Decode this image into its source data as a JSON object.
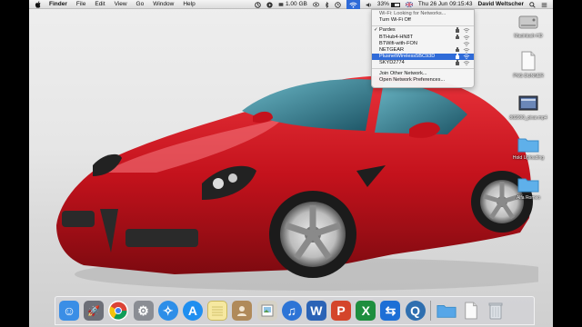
{
  "menubar": {
    "items": [
      "Finder",
      "File",
      "Edit",
      "View",
      "Go",
      "Window",
      "Help"
    ],
    "battery": "33%",
    "storage": "1.00 GB",
    "clock": "Thu 26 Jun  09:15:43",
    "user": "David Weltscher"
  },
  "wifi_menu": {
    "status": "Wi-Fi: Looking for Networks...",
    "toggle": "Turn Wi-Fi Off",
    "networks": [
      {
        "name": "Pardes",
        "checked": true,
        "locked": true
      },
      {
        "name": "BTHub4-HN8T",
        "checked": false,
        "locked": true
      },
      {
        "name": "BTWifi-with-FON",
        "checked": false,
        "locked": false
      },
      {
        "name": "NETGEAR",
        "checked": false,
        "locked": true
      },
      {
        "name": "PlusnetWireless5BC93D",
        "checked": false,
        "locked": true,
        "selected": true
      },
      {
        "name": "SKYD2774",
        "checked": false,
        "locked": true
      }
    ],
    "join_other": "Join Other Network...",
    "preferences": "Open Network Preferences...",
    "checkmark": "✓"
  },
  "desktop_icons": [
    {
      "label": "Macintosh HD",
      "icon": "hard-drive-icon"
    },
    {
      "label": "PNG DUNNER",
      "icon": "document-icon"
    },
    {
      "label": "802900_pixar.mp4",
      "icon": "video-file-icon"
    },
    {
      "label": "Hold Uploading",
      "icon": "folder-icon"
    },
    {
      "label": "Alfa Romeo",
      "icon": "folder-icon"
    }
  ],
  "dock_apps": [
    {
      "name": "finder",
      "glyph": "☺",
      "color": "#3a8ee6"
    },
    {
      "name": "launchpad",
      "glyph": "🚀",
      "color": "#6d6f78"
    },
    {
      "name": "chrome",
      "glyph": "",
      "color": "#ffffff"
    },
    {
      "name": "system-preferences",
      "glyph": "⚙",
      "color": "#8a8d94"
    },
    {
      "name": "safari",
      "glyph": "✧",
      "color": "#2d8ee8"
    },
    {
      "name": "app-store",
      "glyph": "A",
      "color": "#1f8ff0"
    },
    {
      "name": "notes",
      "glyph": "",
      "color": "#f6e8a0"
    },
    {
      "name": "contacts",
      "glyph": "",
      "color": "#b08a5a"
    },
    {
      "name": "preview",
      "glyph": "",
      "color": "#d6d2c6"
    },
    {
      "name": "itunes",
      "glyph": "♫",
      "color": "#2d74d6"
    },
    {
      "name": "word",
      "glyph": "W",
      "color": "#2b63b6"
    },
    {
      "name": "powerpoint",
      "glyph": "P",
      "color": "#d4452b"
    },
    {
      "name": "excel",
      "glyph": "X",
      "color": "#1e8e3e"
    },
    {
      "name": "teamviewer",
      "glyph": "⇆",
      "color": "#1d6fd6"
    },
    {
      "name": "quicktime",
      "glyph": "Q",
      "color": "#2f6fb0"
    },
    {
      "name": "downloads-folder",
      "glyph": "",
      "color": "#56a6e8"
    },
    {
      "name": "documents",
      "glyph": "",
      "color": "#e8e8e8"
    },
    {
      "name": "trash",
      "glyph": "",
      "color": "#cfd3d8"
    }
  ]
}
